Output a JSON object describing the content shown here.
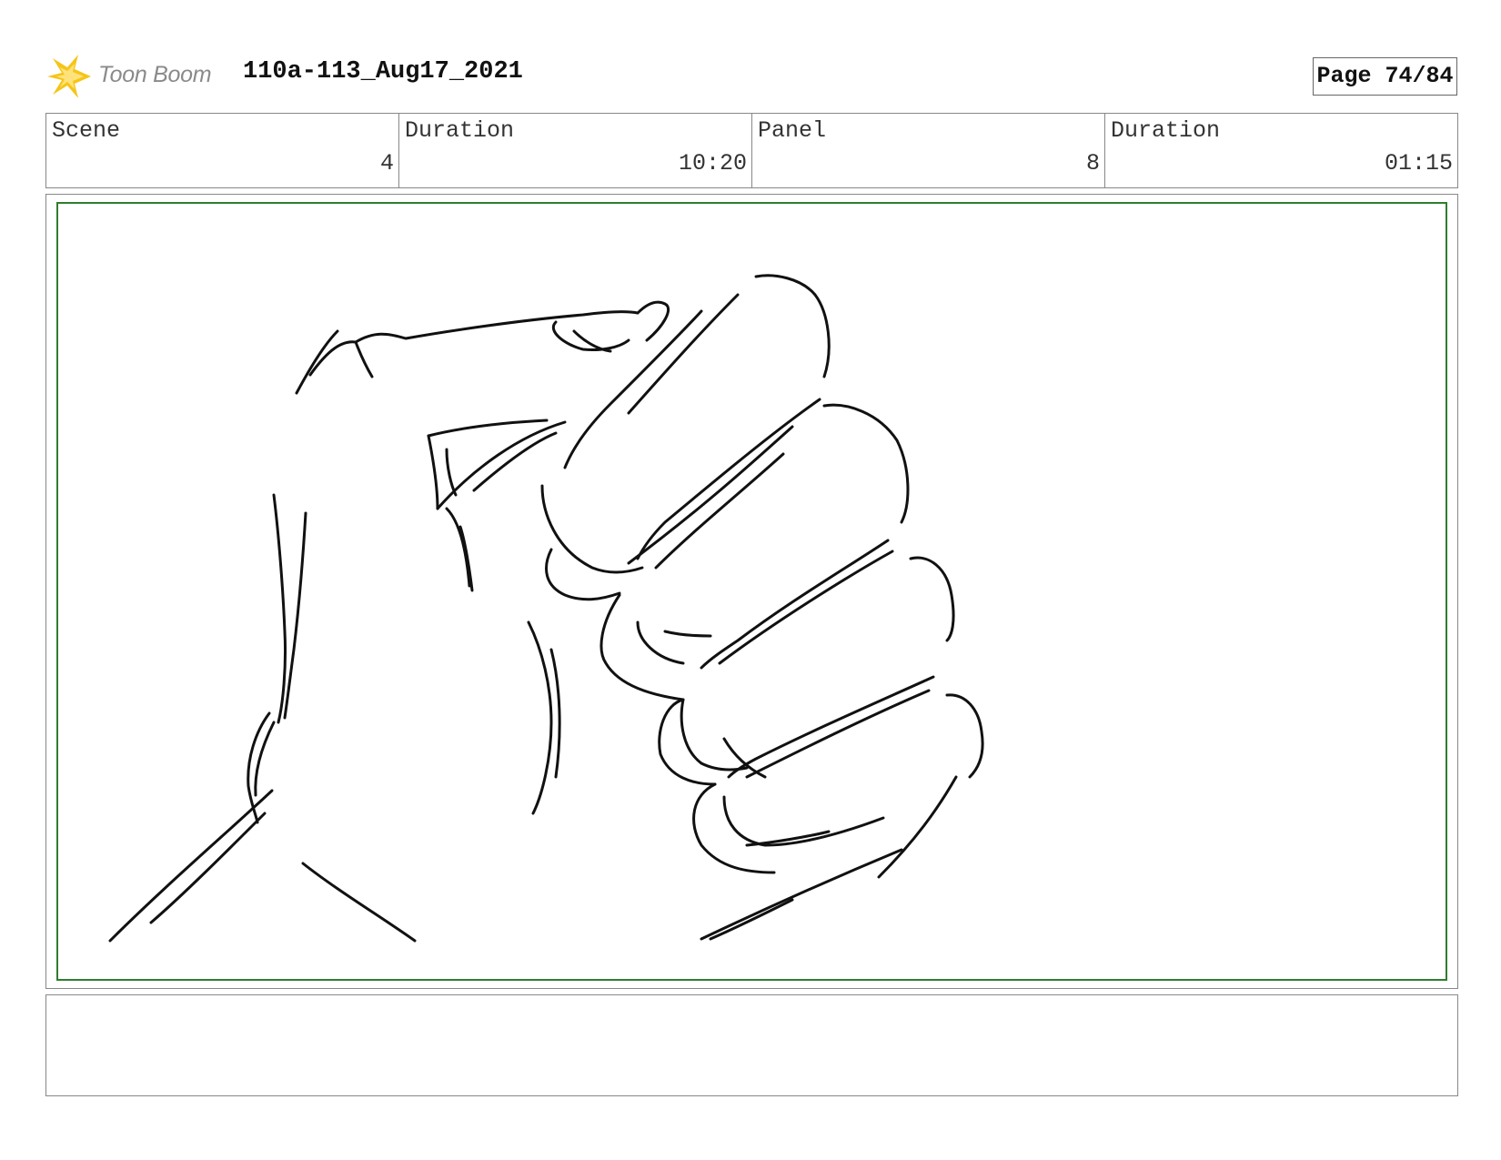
{
  "header": {
    "brand": "Toon Boom",
    "doc_title": "110a-113_Aug17_2021",
    "page_label": "Page 74/84"
  },
  "info": {
    "scene_label": "Scene",
    "scene_value": "4",
    "scene_duration_label": "Duration",
    "scene_duration_value": "10:20",
    "panel_label": "Panel",
    "panel_value": "8",
    "panel_duration_label": "Duration",
    "panel_duration_value": "01:15"
  },
  "colors": {
    "safe_frame": "#2f7d2f",
    "logo_star": "#f5c518",
    "logo_text": "#8a8a8a",
    "sketch_line": "#111111"
  },
  "panel": {
    "image": "sketch of a clenched fist"
  },
  "notes": {
    "dialogue": ""
  }
}
